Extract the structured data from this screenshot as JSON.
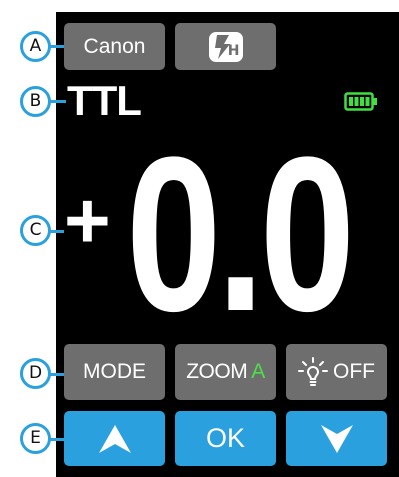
{
  "callouts": {
    "a": "A",
    "b": "B",
    "c": "C",
    "d": "D",
    "e": "E"
  },
  "top_row": {
    "brand_button": "Canon",
    "sync_button_icon": "flash-hss-icon",
    "sync_button_text": "H"
  },
  "status": {
    "mode_text": "TTL",
    "battery_icon": "battery-full-icon",
    "battery_color": "#3fe03f"
  },
  "exposure": {
    "sign": "+",
    "value": "0.0"
  },
  "function_row": {
    "mode_label": "MODE",
    "zoom_label": "ZOOM",
    "zoom_value": "A",
    "lamp_icon": "modeling-lamp-icon",
    "lamp_label": "OFF"
  },
  "nav_row": {
    "up_icon": "arrow-up-icon",
    "ok_label": "OK",
    "down_icon": "arrow-down-icon"
  },
  "colors": {
    "accent_blue": "#2aa0df",
    "button_gray": "#6e6e6e",
    "zoom_green": "#4be04b",
    "screen_bg": "#000000"
  }
}
